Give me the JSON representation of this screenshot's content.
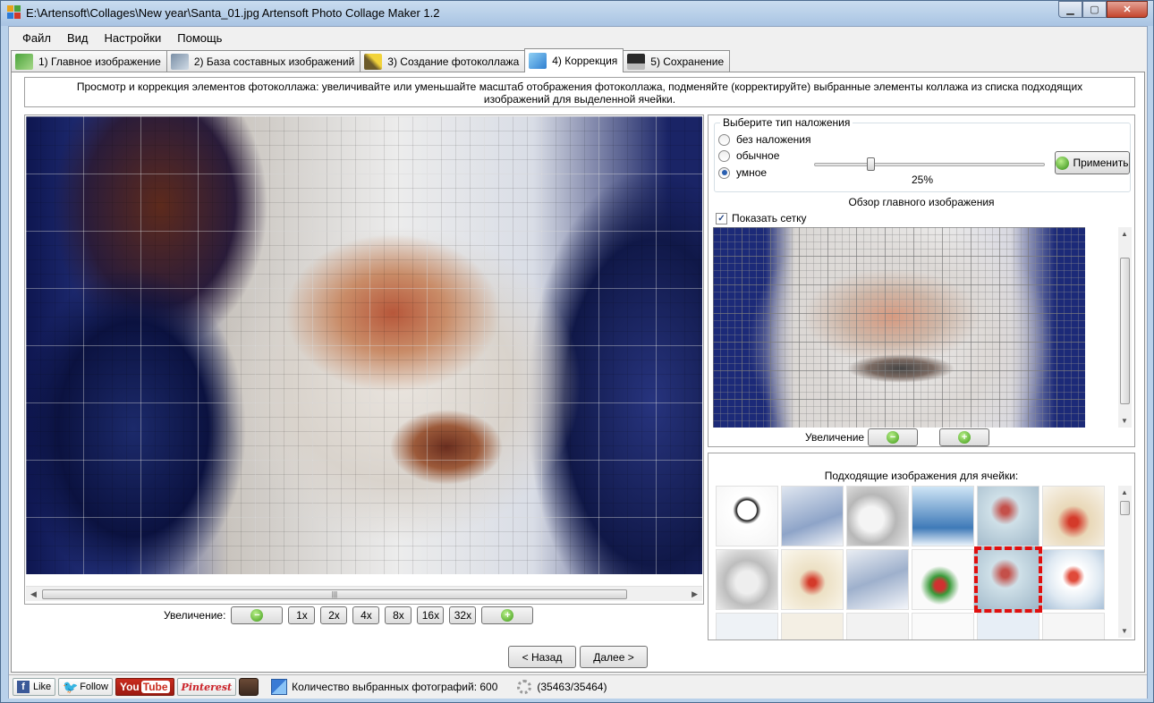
{
  "window": {
    "title": "E:\\Artensoft\\Collages\\New year\\Santa_01.jpg Artensoft Photo Collage Maker 1.2"
  },
  "menu": [
    "Файл",
    "Вид",
    "Настройки",
    "Помощь"
  ],
  "tabs": [
    {
      "label": "1) Главное изображение",
      "icon": "main-image-icon",
      "active": false
    },
    {
      "label": "2) База составных изображений",
      "icon": "image-database-icon",
      "active": false
    },
    {
      "label": "3) Создание фотоколлажа",
      "icon": "magic-wand-icon",
      "active": false
    },
    {
      "label": "4) Коррекция",
      "icon": "cube-icon",
      "active": true
    },
    {
      "label": "5) Сохранение",
      "icon": "floppy-disk-icon",
      "active": false
    }
  ],
  "description": "Просмотр и коррекция элементов фотоколлажа: увеличивайте или уменьшайте масштаб отображения фотоколлажа, подменяйте (корректируйте) выбранные элементы коллажа из списка подходящих изображений для выделенной ячейки.",
  "zoom": {
    "label": "Увеличение:",
    "levels": [
      "1x",
      "2x",
      "4x",
      "8x",
      "16x",
      "32x"
    ]
  },
  "navigation": {
    "back": "< Назад",
    "next": "Далее >"
  },
  "overlay": {
    "title": "Выберите тип наложения",
    "options": [
      "без наложения",
      "обычное",
      "умное"
    ],
    "selected": "умное",
    "percent_text": "25%",
    "level": 0.25,
    "apply": "Применить"
  },
  "overview": {
    "title": "Обзор главного изображения",
    "show_grid_label": "Показать сетку",
    "show_grid": true,
    "zoom_label": "Увеличение"
  },
  "candidates": {
    "title": "Подходящие изображения для ячейки:",
    "selected_index": 10
  },
  "status": {
    "facebook": "Like",
    "twitter": "Follow",
    "youtube_you": "You",
    "youtube_tube": "Tube",
    "pinterest": "Pinterest",
    "count_text": "Количество выбранных фотографий: 600",
    "progress_text": "(35463/35464)"
  }
}
